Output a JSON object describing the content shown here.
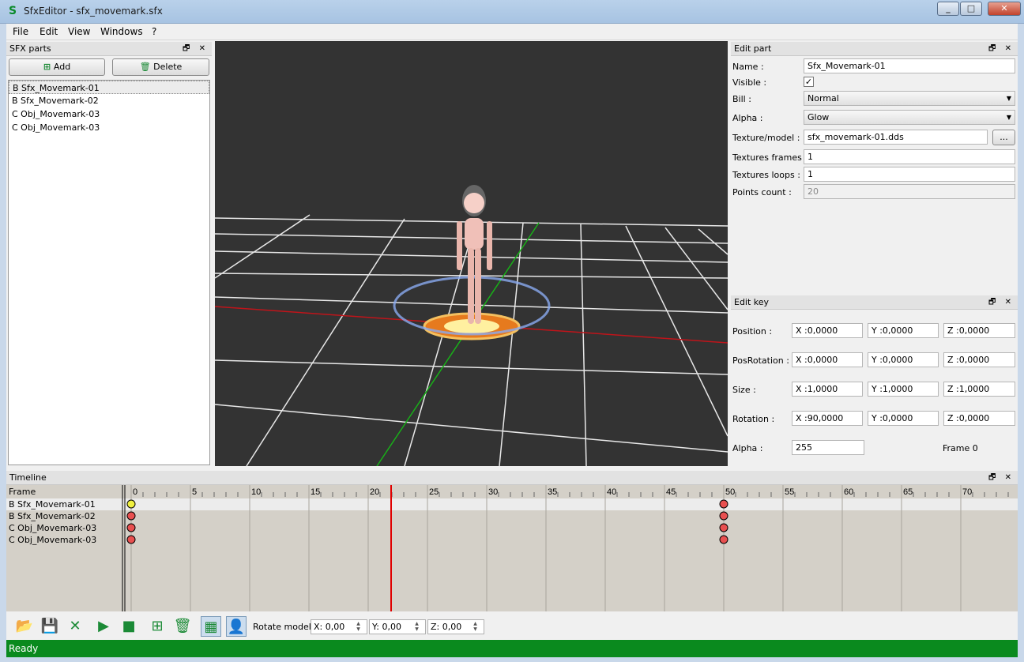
{
  "window": {
    "title": "SfxEditor - sfx_movemark.sfx",
    "app_icon_glyph": "S",
    "min": "_",
    "max": "□",
    "close": "✕"
  },
  "menu": [
    "File",
    "Edit",
    "View",
    "Windows",
    "?"
  ],
  "sfx_parts": {
    "title": "SFX parts",
    "add_label": "Add",
    "delete_label": "Delete",
    "items": [
      "B Sfx_Movemark-01",
      "B Sfx_Movemark-02",
      "C Obj_Movemark-03",
      "C Obj_Movemark-03"
    ],
    "selected_index": 0
  },
  "panel_icons": "🗗 ✕",
  "edit_part": {
    "title": "Edit part",
    "name_label": "Name :",
    "name_value": "Sfx_Movemark-01",
    "visible_label": "Visible :",
    "visible_checked": true,
    "bill_label": "Bill :",
    "bill_value": "Normal",
    "alpha_label": "Alpha :",
    "alpha_value": "Glow",
    "texture_label": "Texture/model :",
    "texture_value": "sfx_movemark-01.dds",
    "browse_label": "...",
    "tex_frames_label": "Textures frames :",
    "tex_frames_value": "1",
    "tex_loops_label": "Textures loops :",
    "tex_loops_value": "1",
    "points_label": "Points count :",
    "points_value": "20"
  },
  "edit_key": {
    "title": "Edit key",
    "rows": [
      {
        "label": "Position :",
        "x": "X :0,0000",
        "y": "Y :0,0000",
        "z": "Z :0,0000"
      },
      {
        "label": "PosRotation :",
        "x": "X :0,0000",
        "y": "Y :0,0000",
        "z": "Z :0,0000"
      },
      {
        "label": "Size :",
        "x": "X :1,0000",
        "y": "Y :1,0000",
        "z": "Z :1,0000"
      },
      {
        "label": "Rotation :",
        "x": "X :90,0000",
        "y": "Y :0,0000",
        "z": "Z :0,0000"
      }
    ],
    "alpha_label": "Alpha :",
    "alpha_value": "255",
    "frame_text": "Frame 0"
  },
  "timeline": {
    "title": "Timeline",
    "frame_label": "Frame",
    "ticks": [
      "0",
      "5",
      "10",
      "15",
      "20",
      "25",
      "30",
      "35",
      "40",
      "45",
      "50",
      "55",
      "60",
      "65",
      "70"
    ],
    "current_frame": 22,
    "rows": [
      {
        "label": "B Sfx_Movemark-01",
        "keys": [
          0,
          50
        ],
        "first_key_selected": true
      },
      {
        "label": "B Sfx_Movemark-02",
        "keys": [
          0,
          50
        ]
      },
      {
        "label": "C Obj_Movemark-03",
        "keys": [
          0,
          50
        ]
      },
      {
        "label": "C Obj_Movemark-03",
        "keys": [
          0,
          50
        ]
      }
    ]
  },
  "toolbar": {
    "rotate_label": "Rotate model :",
    "x_value": "X: 0,00",
    "y_value": "Y: 0,00",
    "z_value": "Z: 0,00",
    "icons": [
      "open-folder-icon",
      "save-icon",
      "close-x-icon",
      "play-icon",
      "stop-icon",
      "add-key-icon",
      "delete-key-icon",
      "grid-toggle-icon",
      "model-toggle-icon"
    ]
  },
  "status": "Ready",
  "colors": {
    "accent_green": "#0a8a1e",
    "viewport_bg": "#333333",
    "red_axis": "#c0141a",
    "green_axis": "#18b018",
    "key_red": "#e85050",
    "key_yellow": "#f0f040",
    "cursor_red": "#e00000"
  }
}
